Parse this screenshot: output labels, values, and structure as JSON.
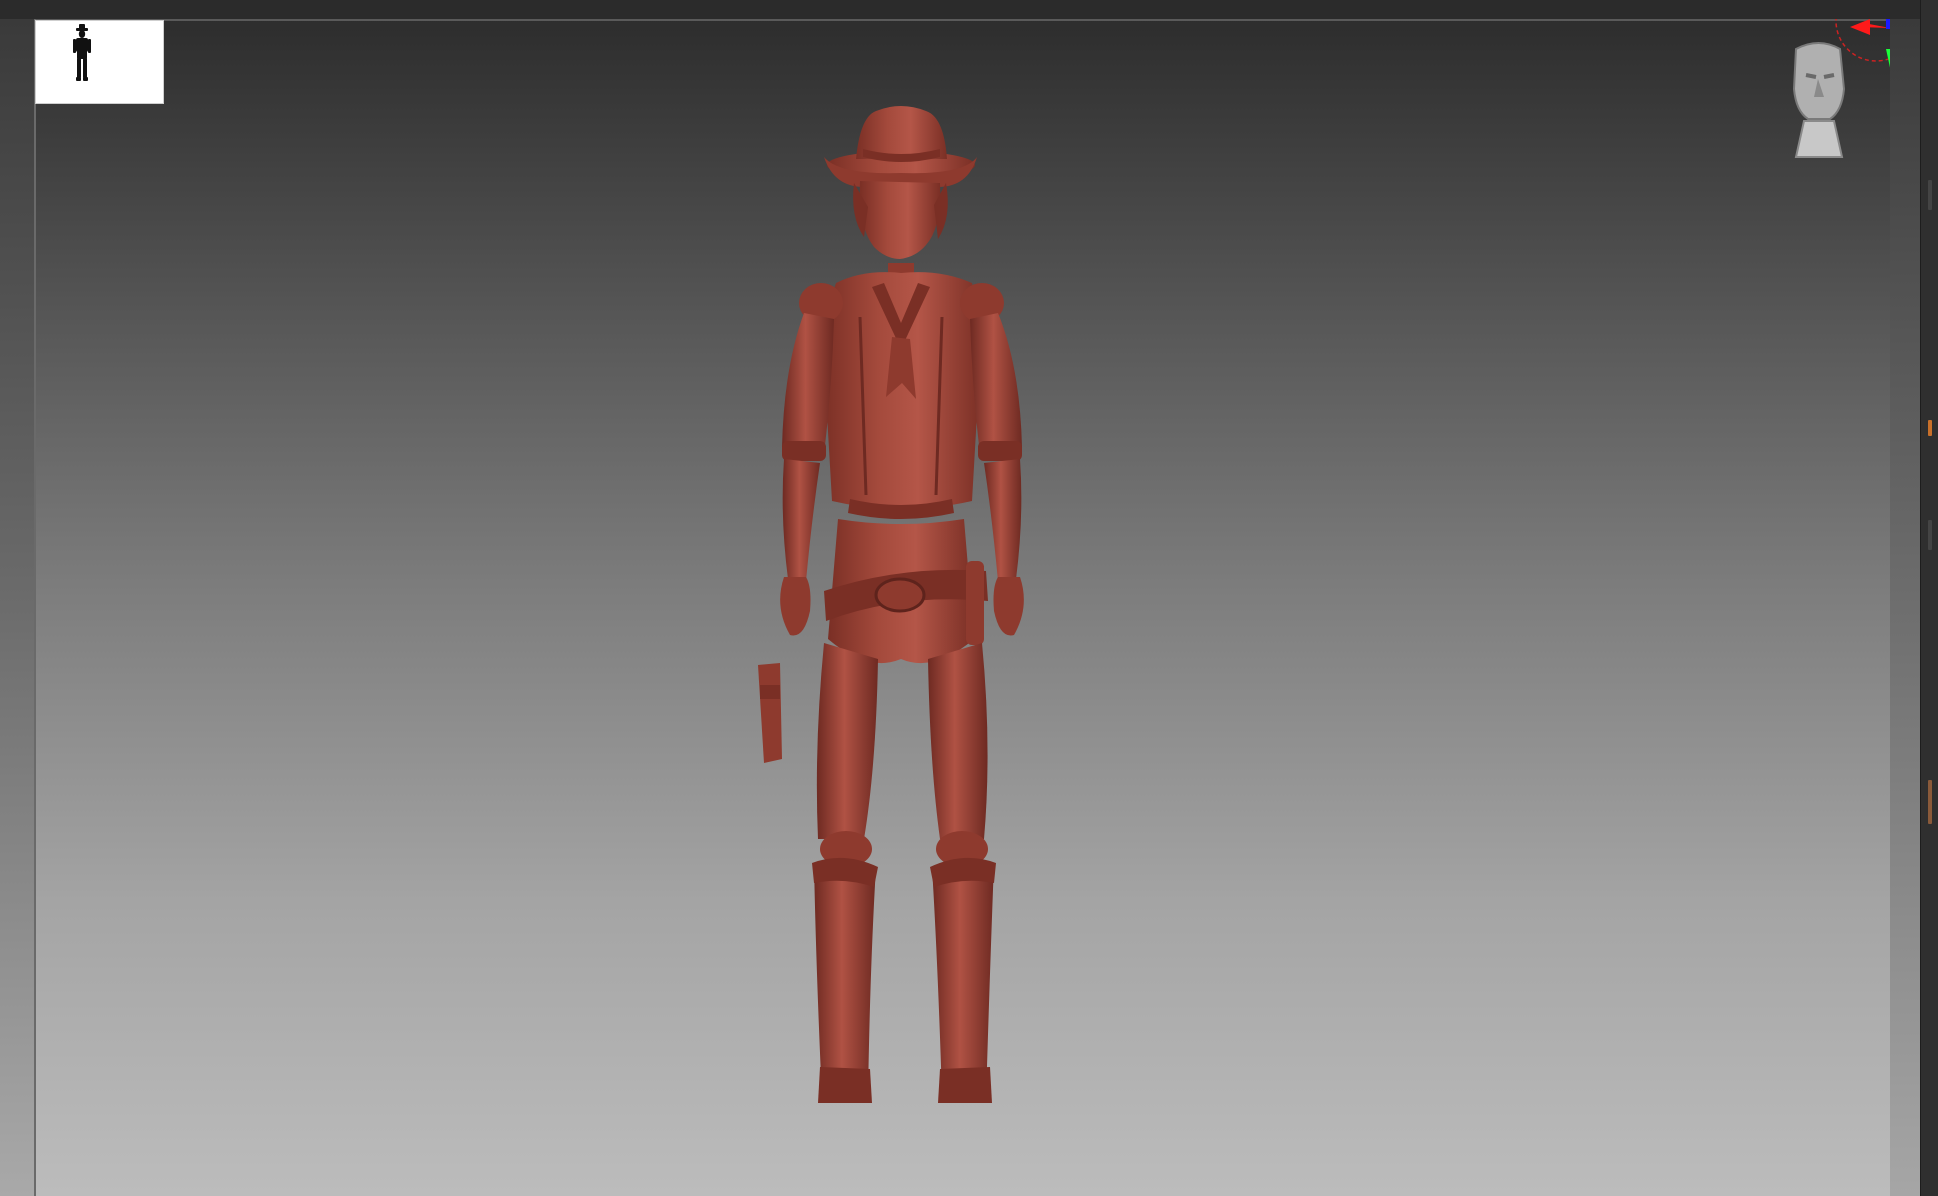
{
  "app": {
    "canvas": {
      "background_top": "#2d2d2d",
      "background_bottom": "#bcbcbc"
    },
    "model": {
      "color": "#a0463a",
      "shadow_color": "#6e2a22",
      "highlight_color": "#c06050"
    },
    "thumbnail": {
      "background": "#ffffff",
      "silhouette_color": "#111111"
    },
    "gizmo": {
      "x_color": "#ff1a1a",
      "y_color": "#1aff3a",
      "z_color": "#1a1aff",
      "ring_color": "#cc2222"
    },
    "nav_head": {
      "color": "#c8c8c8"
    },
    "right_panel": {
      "accent_colors": [
        "#c8702a",
        "#8a5a3a"
      ]
    }
  }
}
